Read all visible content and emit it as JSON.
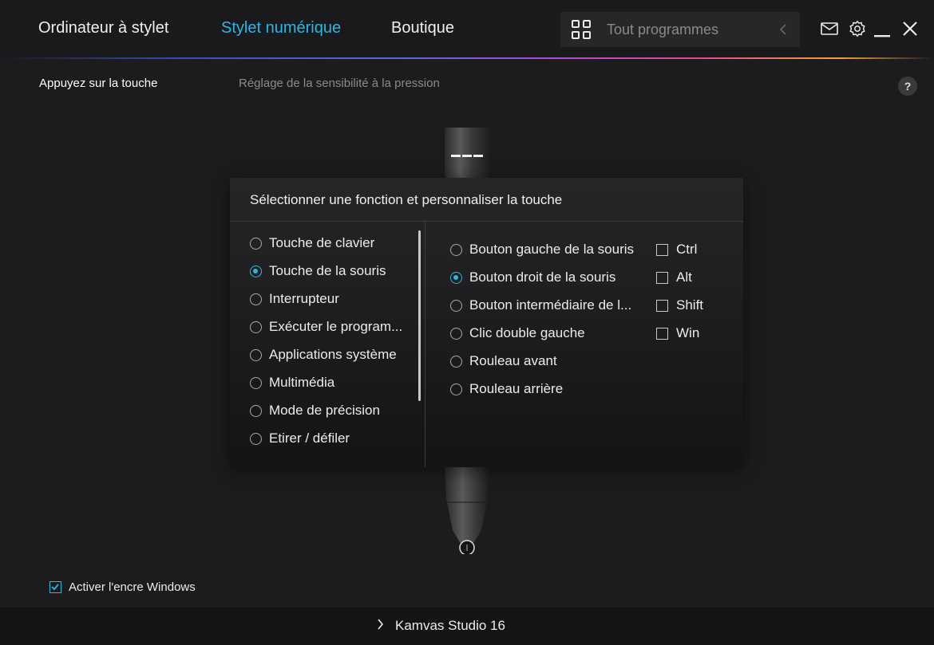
{
  "nav": {
    "tabs": [
      {
        "label": "Ordinateur à stylet",
        "active": false
      },
      {
        "label": "Stylet numérique",
        "active": true
      },
      {
        "label": "Boutique",
        "active": false
      }
    ],
    "program_select": {
      "value": "Tout programmes",
      "icon": "apps-grid-icon"
    },
    "icons": [
      "mail-icon",
      "gear-icon",
      "minimize-icon",
      "close-icon"
    ]
  },
  "subtabs": [
    {
      "label": "Appuyez sur la touche",
      "active": true
    },
    {
      "label": "Réglage de la sensibilité à la pression",
      "active": false
    }
  ],
  "help_label": "?",
  "dialog": {
    "title": "Sélectionner une fonction et personnaliser la touche",
    "functions": [
      {
        "label": "Touche de clavier",
        "checked": false
      },
      {
        "label": "Touche de la souris",
        "checked": true
      },
      {
        "label": "Interrupteur",
        "checked": false
      },
      {
        "label": "Exécuter le program...",
        "checked": false
      },
      {
        "label": "Applications système",
        "checked": false
      },
      {
        "label": "Multimédia",
        "checked": false
      },
      {
        "label": "Mode de précision",
        "checked": false
      },
      {
        "label": "Etirer / défiler",
        "checked": false
      }
    ],
    "mouse_options": [
      {
        "label": "Bouton gauche de la souris",
        "checked": false
      },
      {
        "label": "Bouton droit de la souris",
        "checked": true
      },
      {
        "label": "Bouton intermédiaire de l...",
        "checked": false
      },
      {
        "label": "Clic double gauche",
        "checked": false
      },
      {
        "label": "Rouleau avant",
        "checked": false
      },
      {
        "label": "Rouleau arrière",
        "checked": false
      }
    ],
    "modifiers": [
      {
        "label": "Ctrl",
        "checked": false
      },
      {
        "label": "Alt",
        "checked": false
      },
      {
        "label": "Shift",
        "checked": false
      },
      {
        "label": "Win",
        "checked": false
      }
    ]
  },
  "windows_ink": {
    "label": "Activer l'encre Windows",
    "checked": true
  },
  "device": {
    "label": "Kamvas Studio 16"
  },
  "colors": {
    "accent": "#29b7e6",
    "background": "#1c1c1e",
    "dialog": "#262628"
  }
}
